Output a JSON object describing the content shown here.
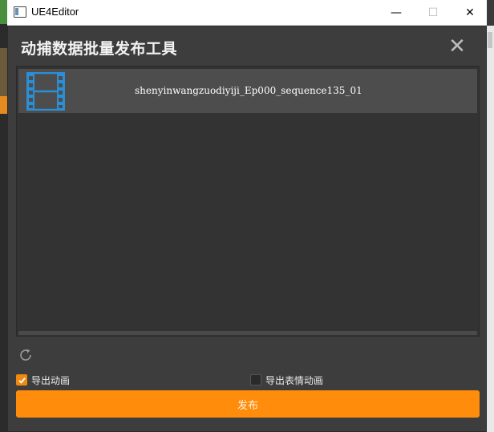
{
  "window": {
    "title": "UE4Editor",
    "buttons": {
      "minimize": "—",
      "maximize": "☐",
      "close": "✕"
    }
  },
  "dialog": {
    "title": "动捕数据批量发布工具",
    "close_glyph": "✕",
    "items": [
      {
        "label": "shenyinwangzuodiyiji_Ep000_sequence135_01",
        "icon": "film-icon"
      }
    ],
    "options": {
      "export_animation": {
        "label": "导出动画",
        "checked": true
      },
      "export_facial_animation": {
        "label": "导出表情动画",
        "checked": false
      }
    },
    "publish_label": "发布"
  },
  "colors": {
    "accent": "#ff8c0a",
    "dialog_bg": "#3d3d3d",
    "list_bg": "#333333",
    "item_bg": "#4d4d4d",
    "film_icon": "#2b8fd6"
  }
}
